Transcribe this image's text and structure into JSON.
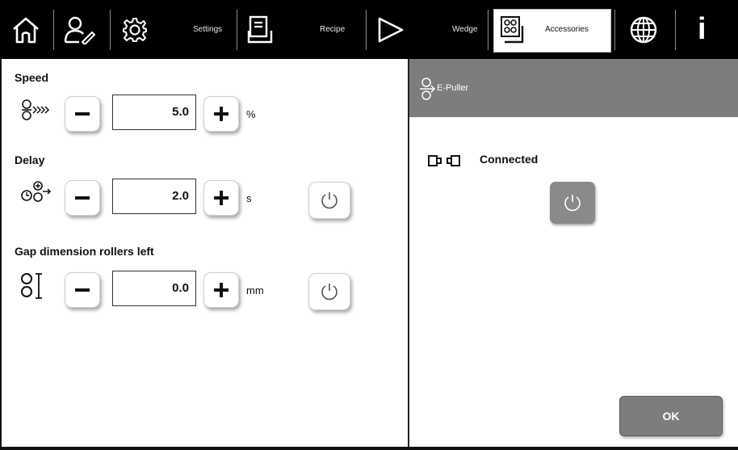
{
  "toolbar": {
    "settings_label": "Settings",
    "recipe_label": "Recipe",
    "wedge_label": "Wedge",
    "accessories_label": "Accessories",
    "info_label": "i"
  },
  "parameters": [
    {
      "title": "Speed",
      "value": "5.0",
      "unit": "%"
    },
    {
      "title": "Delay",
      "value": "2.0",
      "unit": "s"
    },
    {
      "title": "Gap dimension rollers left",
      "value": "0.0",
      "unit": "mm"
    }
  ],
  "device_panel": {
    "title": "E-Puller",
    "status": "Connected"
  },
  "ok_label": "OK",
  "colors": {
    "toolbar_bg": "#000000",
    "panel_header_bg": "#7d7d7d",
    "ok_button_bg": "#7d7d7d"
  }
}
